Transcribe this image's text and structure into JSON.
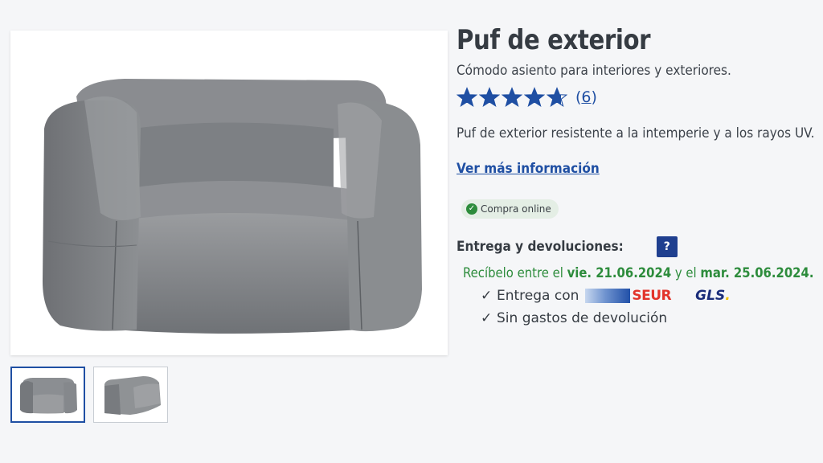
{
  "product": {
    "title": "Puf de exterior",
    "subtitle": "Cómodo asiento para interiores y exteriores.",
    "rating_value": 4.7,
    "rating_max": 5,
    "review_count": "6",
    "description": "Puf de exterior resistente a la intemperie y a los rayos UV.",
    "more_info_link": "Ver más información",
    "badge": "Compra online"
  },
  "gallery": {
    "main_image": "grey-bean-bag-armchair-front",
    "thumbnails": [
      "grey-bean-bag-armchair-front",
      "grey-bean-bag-armchair-side"
    ],
    "active_thumbnail": 0
  },
  "delivery": {
    "title": "Entrega y devoluciones:",
    "help_label": "?",
    "receive_prefix": "Recíbelo entre el",
    "date_from": "vie. 21.06.2024",
    "connector": "y el",
    "date_to": "mar. 25.06.2024.",
    "items": [
      "Entrega con",
      "Sin gastos de devolución"
    ],
    "carriers": [
      "SEUR",
      "GLS"
    ],
    "check_mark": "✓"
  },
  "colors": {
    "link_blue": "#1f4fa3",
    "star_blue": "#1f4fa3",
    "delivery_green": "#2d8c3c",
    "seur_red": "#e2342b",
    "gls_blue": "#1a2d7a"
  }
}
